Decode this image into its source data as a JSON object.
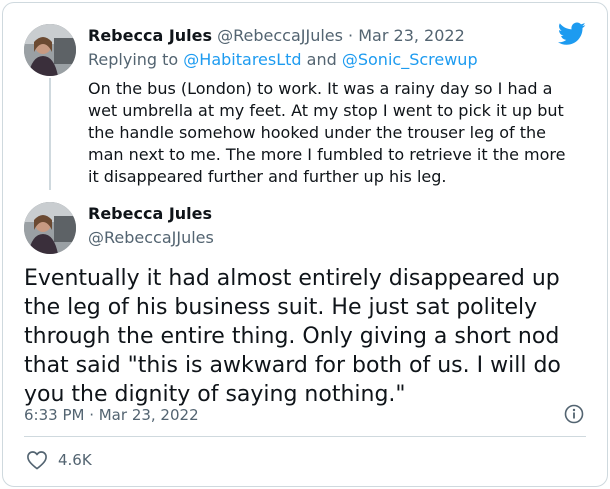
{
  "colors": {
    "link": "#1d9bf0",
    "muted": "#536471",
    "text": "#0f1419",
    "border": "#cfd9de"
  },
  "brand_icon": "twitter-bird-icon",
  "reply_tweet": {
    "display_name": "Rebecca Jules",
    "handle": "@RebeccaJJules",
    "separator": "·",
    "date": "Mar 23, 2022",
    "replying_prefix": "Replying to",
    "reply_to_1": "@HabitaresLtd",
    "reply_and": "and",
    "reply_to_2": "@Sonic_Screwup",
    "body_lines": [
      "On the bus (London) to work. It was a rainy day so I had a",
      "wet umbrella at my feet. At my stop I went to pick it up but",
      "the handle somehow hooked under the trouser leg of the",
      "man next to me. The more I fumbled to retrieve it the more",
      "it disappeared further and further up his leg."
    ]
  },
  "main_tweet": {
    "display_name": "Rebecca Jules",
    "handle": "@RebeccaJJules",
    "body_lines": [
      "Eventually it had almost entirely disappeared up",
      "the leg of his business suit. He just sat politely",
      "through the entire thing. Only giving a short nod",
      "that said \"this is awkward for both of us. I will do",
      "you the dignity of saying nothing.\""
    ],
    "timestamp": "6:33 PM · Mar 23, 2022",
    "info_icon": "info-icon",
    "like_icon": "heart-icon",
    "like_count": "4.6K"
  }
}
